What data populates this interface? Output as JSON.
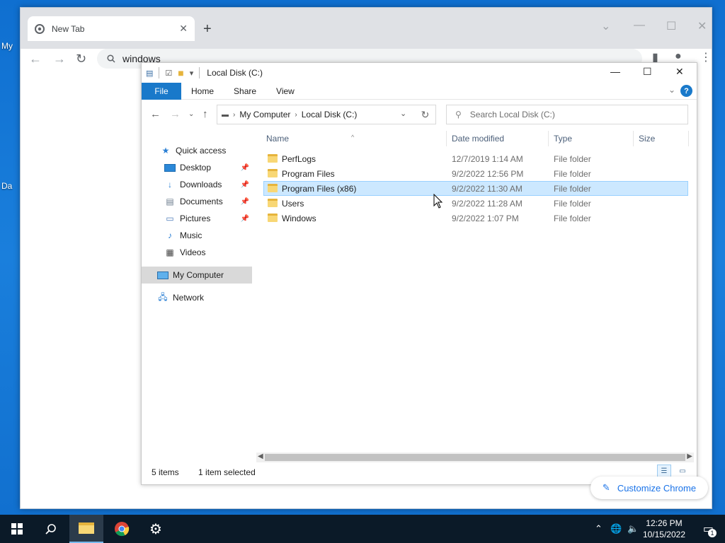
{
  "desktop": {
    "labels": [
      "My",
      "Da"
    ]
  },
  "chrome": {
    "tab_title": "New Tab",
    "omnibox_text": "windows",
    "customize_label": "Customize Chrome"
  },
  "explorer": {
    "title": "Local Disk (C:)",
    "ribbon_tabs": [
      "File",
      "Home",
      "Share",
      "View"
    ],
    "breadcrumb": [
      "My Computer",
      "Local Disk (C:)"
    ],
    "search_placeholder": "Search Local Disk (C:)",
    "nav": [
      {
        "label": "Quick access",
        "icon": "star-icon"
      },
      {
        "label": "Desktop",
        "icon": "desktop-icon",
        "pinned": true
      },
      {
        "label": "Downloads",
        "icon": "download-icon",
        "pinned": true
      },
      {
        "label": "Documents",
        "icon": "document-icon",
        "pinned": true
      },
      {
        "label": "Pictures",
        "icon": "picture-icon",
        "pinned": true
      },
      {
        "label": "Music",
        "icon": "music-icon"
      },
      {
        "label": "Videos",
        "icon": "video-icon"
      },
      {
        "label": "My Computer",
        "icon": "computer-icon",
        "selected": true
      },
      {
        "label": "Network",
        "icon": "network-icon"
      }
    ],
    "columns": [
      "Name",
      "Date modified",
      "Type",
      "Size"
    ],
    "files": [
      {
        "name": "PerfLogs",
        "date": "12/7/2019 1:14 AM",
        "type": "File folder"
      },
      {
        "name": "Program Files",
        "date": "9/2/2022 12:56 PM",
        "type": "File folder"
      },
      {
        "name": "Program Files (x86)",
        "date": "9/2/2022 11:30 AM",
        "type": "File folder",
        "selected": true
      },
      {
        "name": "Users",
        "date": "9/2/2022 11:28 AM",
        "type": "File folder"
      },
      {
        "name": "Windows",
        "date": "9/2/2022 1:07 PM",
        "type": "File folder"
      }
    ],
    "status_items": "5 items",
    "status_selected": "1 item selected"
  },
  "taskbar": {
    "time": "12:26 PM",
    "date": "10/15/2022",
    "notification_count": "1"
  },
  "colors": {
    "accent": "#1979ca",
    "selection": "#cce8ff",
    "taskbar": "#0b1a28"
  }
}
